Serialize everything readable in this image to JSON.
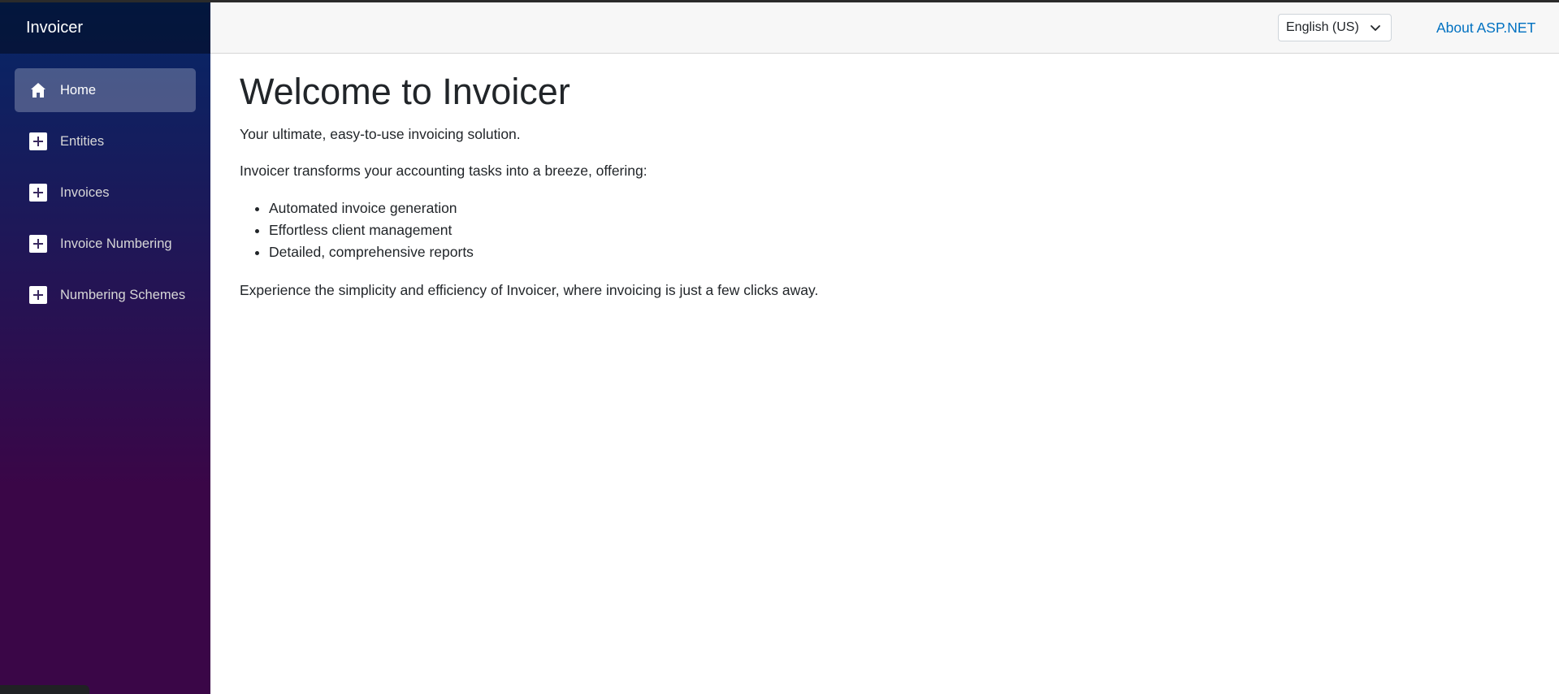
{
  "sidebar": {
    "brand": "Invoicer",
    "items": [
      {
        "label": "Home",
        "icon": "home-icon",
        "active": true
      },
      {
        "label": "Entities",
        "icon": "plus-icon",
        "active": false
      },
      {
        "label": "Invoices",
        "icon": "plus-icon",
        "active": false
      },
      {
        "label": "Invoice Numbering",
        "icon": "plus-icon",
        "active": false
      },
      {
        "label": "Numbering Schemes",
        "icon": "plus-icon",
        "active": false
      }
    ]
  },
  "header": {
    "language": "English (US)",
    "about_link": "About ASP.NET"
  },
  "main": {
    "title": "Welcome to Invoicer",
    "subtitle": "Your ultimate, easy-to-use invoicing solution.",
    "intro": "Invoicer transforms your accounting tasks into a breeze, offering:",
    "features": [
      "Automated invoice generation",
      "Effortless client management",
      "Detailed, comprehensive reports"
    ],
    "closing": "Experience the simplicity and efficiency of Invoicer, where invoicing is just a few clicks away."
  },
  "colors": {
    "sidebar_top": "#052767",
    "sidebar_bottom": "#3a0647",
    "link": "#0071c1"
  }
}
